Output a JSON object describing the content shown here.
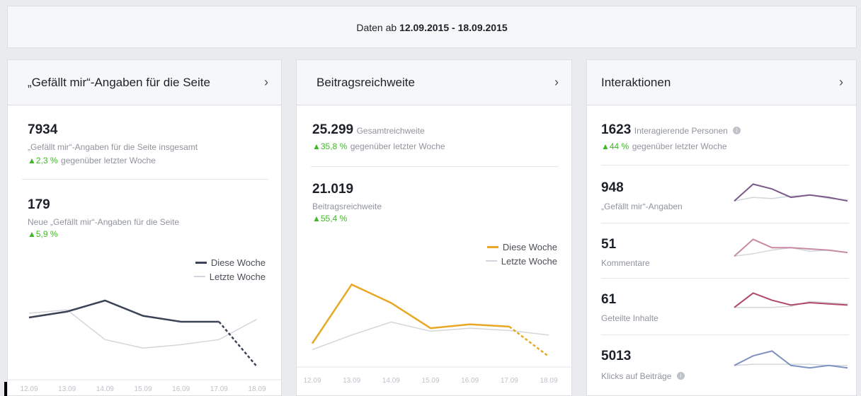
{
  "header": {
    "date_prefix": "Daten ab",
    "date_range": "12.09.2015 - 18.09.2015"
  },
  "likes_card": {
    "title": "„Gefällt mir“-Angaben für die Seite",
    "total_value": "7934",
    "total_label": "„Gefällt mir“-Angaben für die Seite insgesamt",
    "total_change": "▲2,3 %",
    "total_change_suffix": "gegenüber letzter Woche",
    "new_value": "179",
    "new_label": "Neue „Gefällt mir“-Angaben für die Seite",
    "new_change": "▲5,9 %",
    "legend_this": "Diese Woche",
    "legend_last": "Letzte Woche"
  },
  "reach_card": {
    "title": "Beitragsreichweite",
    "total_value": "25.299",
    "total_label": "Gesamtreichweite",
    "total_change": "▲35,8 %",
    "total_change_suffix": "gegenüber letzter Woche",
    "post_value": "21.019",
    "post_label": "Beitragsreichweite",
    "post_change": "▲55,4 %",
    "legend_this": "Diese Woche",
    "legend_last": "Letzte Woche"
  },
  "interactions_card": {
    "title": "Interaktionen",
    "total_value": "1623",
    "total_label": "Interagierende Personen",
    "total_change": "▲44 %",
    "total_change_suffix": "gegenüber letzter Woche",
    "metrics": [
      {
        "value": "948",
        "label": "„Gefällt mir“-Angaben",
        "color": "#7b5a8a"
      },
      {
        "value": "51",
        "label": "Kommentare",
        "color": "#c98aa4"
      },
      {
        "value": "61",
        "label": "Geteilte Inhalte",
        "color": "#b04a6a"
      },
      {
        "value": "5013",
        "label": "Klicks auf Beiträge",
        "color": "#7f93c0"
      }
    ]
  },
  "colors": {
    "likes_this_week": "#3b4457",
    "reach_this_week": "#e8a825",
    "last_week": "#d3d6db"
  },
  "chart_data": [
    {
      "type": "line",
      "categories": [
        "12.09",
        "13.09",
        "14.09",
        "15.09",
        "16.09",
        "17.09",
        "18.09"
      ],
      "series": [
        {
          "name": "Diese Woche",
          "values": [
            60,
            67,
            80,
            62,
            55,
            55,
            2
          ]
        },
        {
          "name": "Letzte Woche",
          "values": [
            65,
            69,
            34,
            24,
            28,
            34,
            58
          ]
        }
      ],
      "ylim": [
        0,
        100
      ]
    },
    {
      "type": "line",
      "categories": [
        "12.09",
        "13.09",
        "14.09",
        "15.09",
        "16.09",
        "17.09",
        "18.09"
      ],
      "series": [
        {
          "name": "Diese Woche",
          "values": [
            7,
            84,
            60,
            27,
            32,
            29,
            -10
          ]
        },
        {
          "name": "Letzte Woche",
          "values": [
            -1,
            18,
            35,
            23,
            27,
            24,
            18
          ]
        }
      ],
      "ylim": [
        -20,
        100
      ]
    },
    {
      "type": "line",
      "categories": [
        "12.09",
        "13.09",
        "14.09",
        "15.09",
        "16.09",
        "17.09",
        "18.09"
      ],
      "series": [
        {
          "values": [
            20,
            90,
            70,
            35,
            45,
            35,
            20
          ]
        },
        {
          "values": [
            20,
            35,
            30,
            40,
            45,
            30,
            25
          ]
        }
      ]
    },
    {
      "type": "line",
      "categories": [
        "12.09",
        "13.09",
        "14.09",
        "15.09",
        "16.09",
        "17.09",
        "18.09"
      ],
      "series": [
        {
          "values": [
            20,
            90,
            55,
            55,
            50,
            45,
            35
          ]
        },
        {
          "values": [
            20,
            30,
            45,
            55,
            40,
            45,
            35
          ]
        }
      ]
    },
    {
      "type": "line",
      "categories": [
        "12.09",
        "13.09",
        "14.09",
        "15.09",
        "16.09",
        "17.09",
        "18.09"
      ],
      "series": [
        {
          "values": [
            30,
            90,
            60,
            40,
            50,
            45,
            40
          ]
        },
        {
          "values": [
            30,
            30,
            30,
            35,
            55,
            50,
            45
          ]
        }
      ]
    },
    {
      "type": "line",
      "categories": [
        "12.09",
        "13.09",
        "14.09",
        "15.09",
        "16.09",
        "17.09",
        "18.09"
      ],
      "series": [
        {
          "values": [
            30,
            70,
            90,
            30,
            20,
            30,
            20
          ]
        },
        {
          "values": [
            30,
            35,
            35,
            35,
            35,
            30,
            30
          ]
        }
      ]
    }
  ]
}
